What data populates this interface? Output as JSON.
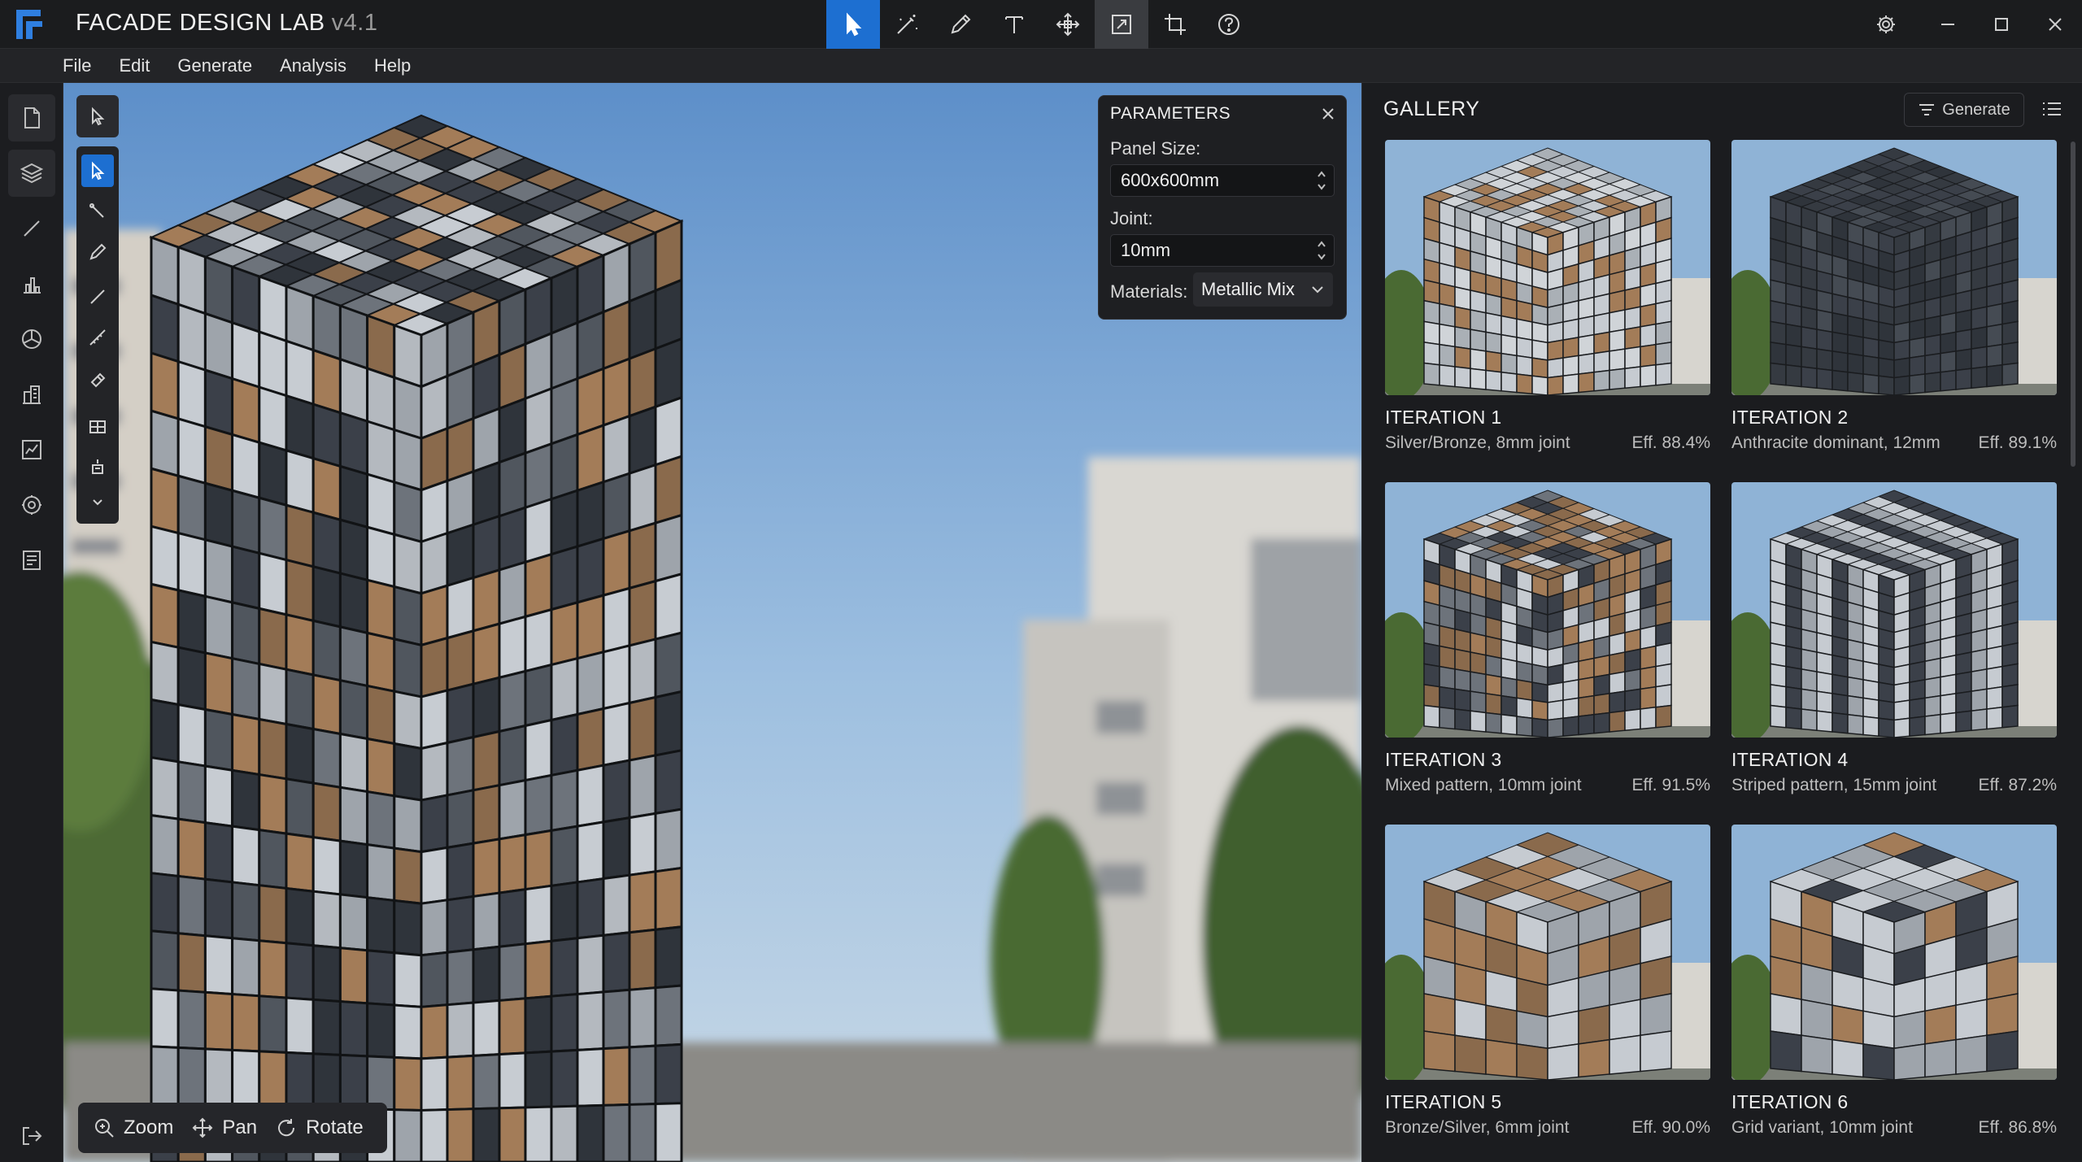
{
  "app": {
    "title": "FACADE DESIGN LAB",
    "version": "v4.1"
  },
  "toolbar": {
    "tools": [
      "select-pointer",
      "magic-wand",
      "pencil",
      "text",
      "move",
      "frame-select",
      "crop",
      "help"
    ],
    "active_tool": "select-pointer"
  },
  "menu": {
    "items": [
      "File",
      "Edit",
      "Generate",
      "Analysis",
      "Help"
    ]
  },
  "sidebar": {
    "icons": [
      "document",
      "layers",
      "line",
      "chart-bars",
      "cube",
      "building",
      "analytics",
      "settings",
      "notes",
      "exit"
    ]
  },
  "view_controls": {
    "zoom": "Zoom",
    "pan": "Pan",
    "rotate": "Rotate"
  },
  "parameters": {
    "title": "PARAMETERS",
    "panel_size_label": "Panel Size:",
    "panel_size_value": "600x600mm",
    "joint_label": "Joint:",
    "joint_value": "10mm",
    "materials_label": "Materials:",
    "materials_value": "Metallic Mix"
  },
  "gallery": {
    "title": "GALLERY",
    "generate_label": "Generate",
    "items": [
      {
        "title": "ITERATION 1",
        "desc": "Silver/Bronze, 8mm joint",
        "eff": "Eff. 88.4%"
      },
      {
        "title": "ITERATION 2",
        "desc": "Anthracite dominant, 12mm",
        "eff": "Eff. 89.1%"
      },
      {
        "title": "ITERATION 3",
        "desc": "Mixed pattern, 10mm joint",
        "eff": "Eff. 91.5%"
      },
      {
        "title": "ITERATION 4",
        "desc": "Striped pattern, 15mm joint",
        "eff": "Eff. 87.2%"
      },
      {
        "title": "ITERATION 5",
        "desc": "Bronze/Silver, 6mm joint",
        "eff": "Eff. 90.0%"
      },
      {
        "title": "ITERATION 6",
        "desc": "Grid variant, 10mm joint",
        "eff": "Eff. 86.8%"
      }
    ]
  },
  "colors": {
    "accent": "#1d6fd1",
    "bronze": "#a07a55",
    "silver": "#b9bec4",
    "anthracite": "#3a3f47"
  }
}
